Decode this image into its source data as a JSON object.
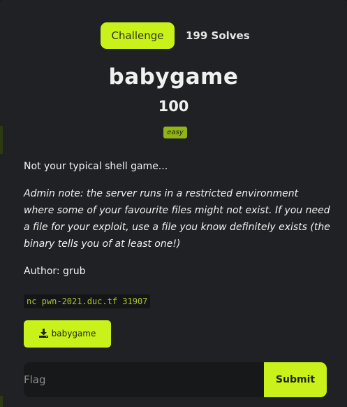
{
  "tabs": {
    "challenge_label": "Challenge",
    "solves_label": "199 Solves"
  },
  "challenge": {
    "name": "babygame",
    "points": "100",
    "tag": "easy",
    "description": "Not your typical shell game...",
    "admin_note": "Admin note: the server runs in a restricted environment where some of your favourite files might not exist. If you need a file for your exploit, use a file you know definitely exists (the binary tells you of at least one!)",
    "author": "Author: grub",
    "connection": "nc pwn-2021.duc.tf 31907"
  },
  "files": {
    "download_label": "babygame",
    "icon": "download-icon"
  },
  "flag_form": {
    "placeholder": "Flag",
    "value": "",
    "submit_label": "Submit"
  },
  "colors": {
    "accent": "#c8f21a",
    "background": "#1f2124",
    "code_text": "#a8c72d",
    "tag_bg": "#93b416"
  }
}
